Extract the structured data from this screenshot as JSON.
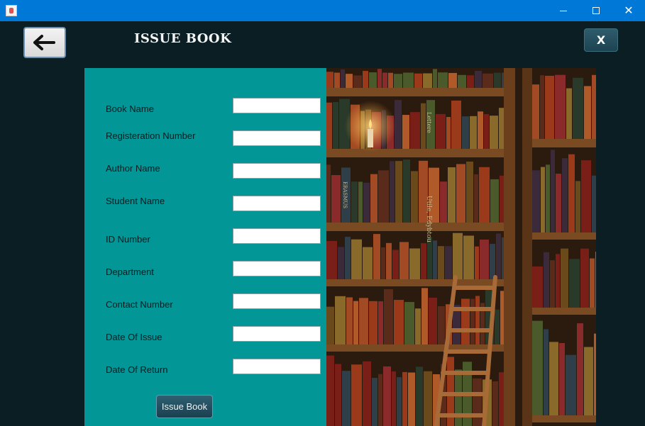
{
  "window": {
    "title": "",
    "controls": {
      "minimize": "minimize-icon",
      "maximize": "maximize-icon",
      "close": "close-icon"
    }
  },
  "header": {
    "back_button_icon": "back-arrow-icon",
    "title": "ISSUE BOOK",
    "close_label": "X"
  },
  "form": {
    "fields": [
      {
        "label": "Book Name",
        "value": ""
      },
      {
        "label": "Registeration Number",
        "value": ""
      },
      {
        "label": "Author Name",
        "value": ""
      },
      {
        "label": "Student Name",
        "value": ""
      },
      {
        "label": "ID Number",
        "value": ""
      },
      {
        "label": "Department",
        "value": ""
      },
      {
        "label": "Contact Number",
        "value": ""
      },
      {
        "label": "Date Of Issue",
        "value": ""
      },
      {
        "label": "Date Of Return",
        "value": ""
      }
    ],
    "submit_label": "Issue Book"
  },
  "image": {
    "subject": "library-bookshelf-with-ladder-and-candle",
    "spine_texts": [
      "Lettere",
      "Utile, Edybtou",
      "ERASMUS"
    ]
  },
  "colors": {
    "background": "#0a1e24",
    "form_panel": "#039696",
    "titlebar": "#0078d7"
  }
}
